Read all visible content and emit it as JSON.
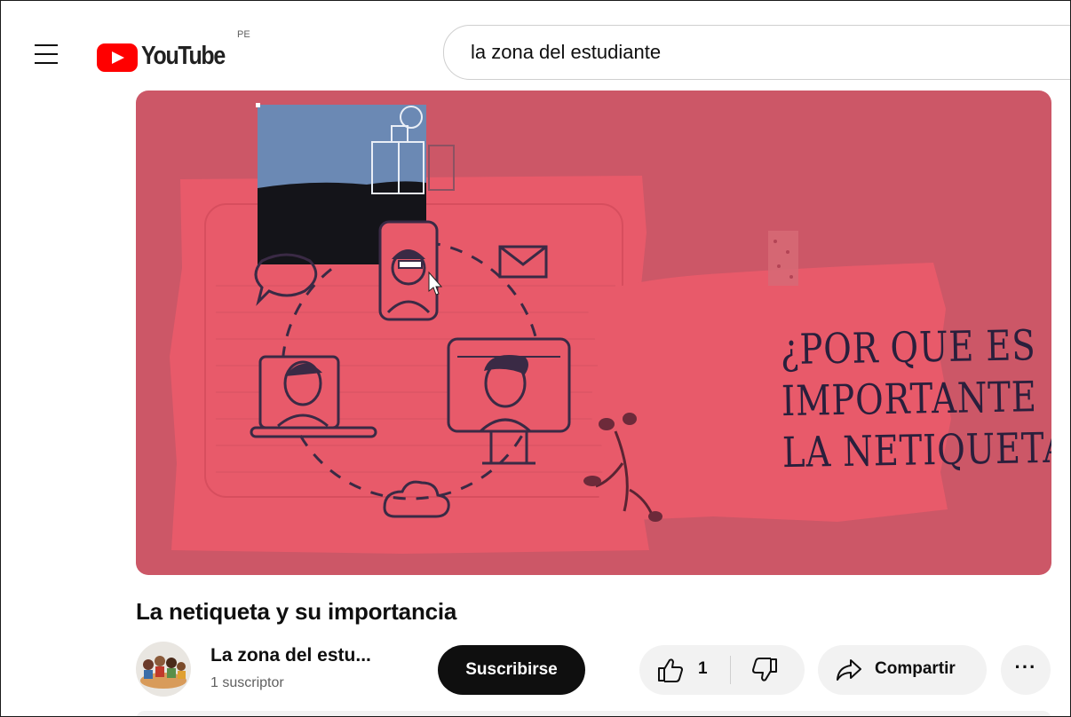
{
  "header": {
    "logo_text": "YouTube",
    "region_code": "PE",
    "search_query": "la zona del estudiante"
  },
  "video": {
    "title": "La netiqueta y su importancia",
    "thumbnail_headline": [
      "¿POR QUE ES",
      "IMPORTANTE",
      "LA NETIQUETA?"
    ],
    "background_color": "#cc5767"
  },
  "channel": {
    "name": "La zona del estu...",
    "subscribers": "1 suscriptor"
  },
  "actions": {
    "subscribe_label": "Suscribirse",
    "like_count": "1",
    "share_label": "Compartir",
    "more_label": "···"
  },
  "icons": [
    "menu-icon",
    "youtube-logo",
    "like-icon",
    "dislike-icon",
    "share-icon",
    "more-icon"
  ]
}
